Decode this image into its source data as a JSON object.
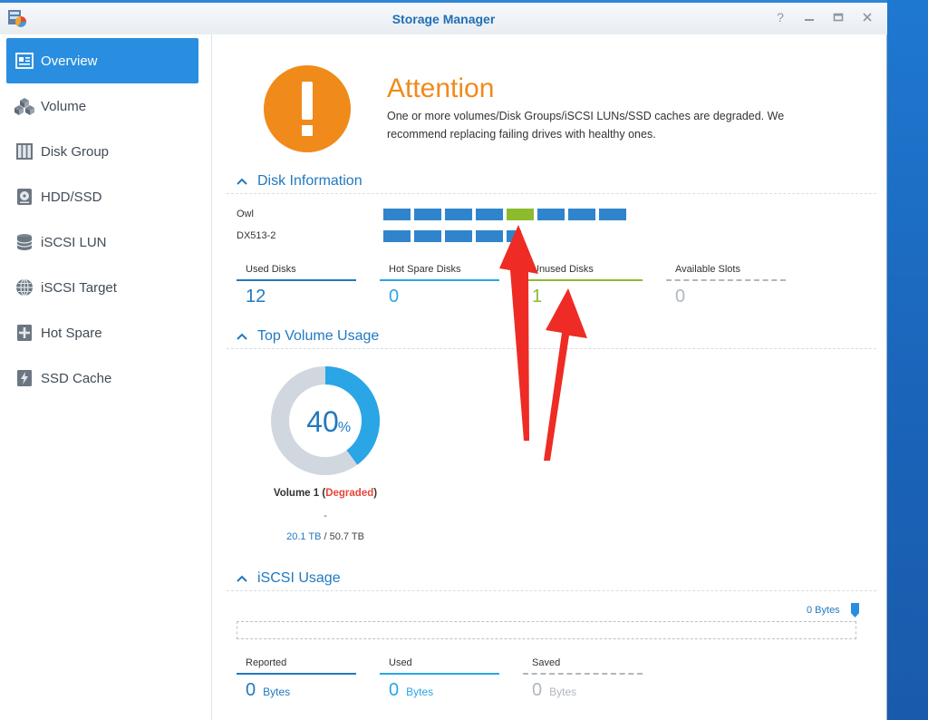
{
  "window": {
    "title": "Storage Manager",
    "controls": [
      "?",
      "–",
      "□",
      "×"
    ]
  },
  "sidebar": {
    "items": [
      {
        "label": "Overview",
        "icon": "overview-icon",
        "active": true
      },
      {
        "label": "Volume",
        "icon": "volume-icon"
      },
      {
        "label": "Disk Group",
        "icon": "disk-group-icon"
      },
      {
        "label": "HDD/SSD",
        "icon": "hdd-icon"
      },
      {
        "label": "iSCSI LUN",
        "icon": "iscsi-lun-icon"
      },
      {
        "label": "iSCSI Target",
        "icon": "iscsi-target-icon"
      },
      {
        "label": "Hot Spare",
        "icon": "hot-spare-icon"
      },
      {
        "label": "SSD Cache",
        "icon": "ssd-cache-icon"
      }
    ]
  },
  "attention": {
    "title": "Attention",
    "message_line1": "One or more volumes/Disk Groups/iSCSI LUNs/SSD caches are degraded. We",
    "message_line2": "recommend replacing failing drives with healthy ones.",
    "color": "#f08a1b"
  },
  "disk_info": {
    "header": "Disk Information",
    "devices": [
      {
        "name": "Owl",
        "disks": [
          "used",
          "used",
          "used",
          "used",
          "unused",
          "used",
          "used",
          "used"
        ]
      },
      {
        "name": "DX513-2",
        "disks": [
          "used",
          "used",
          "used",
          "used",
          "used"
        ]
      }
    ],
    "stats": [
      {
        "label": "Used Disks",
        "value": "12",
        "color": "#2179c0"
      },
      {
        "label": "Hot Spare Disks",
        "value": "0",
        "color": "#2aa6e6"
      },
      {
        "label": "Unused Disks",
        "value": "1",
        "color": "#8dbb2e"
      },
      {
        "label": "Available Slots",
        "value": "0",
        "color": "#b0b7bf"
      }
    ]
  },
  "volume_usage": {
    "header": "Top Volume Usage",
    "percent": "40",
    "percent_sign": "%",
    "percent_fraction": 0.4,
    "volume_name": "Volume 1 (",
    "status": "Degraded",
    "close_paren": ")",
    "dash": "-",
    "used": "20.1 TB",
    "separator": " / ",
    "total": "50.7 TB"
  },
  "iscsi_usage": {
    "header": "iSCSI Usage",
    "bar_label": "0 Bytes",
    "stats": [
      {
        "label": "Reported",
        "value": "0",
        "unit": "Bytes",
        "color": "#2179c0"
      },
      {
        "label": "Used",
        "value": "0",
        "unit": "Bytes",
        "color": "#2aa6e6"
      },
      {
        "label": "Saved",
        "value": "0",
        "unit": "Bytes",
        "color": "#b0b7bf"
      }
    ]
  },
  "colors": {
    "accent": "#2a8ee0",
    "used_disk": "#2f84cc",
    "unused_disk": "#8dbb2e",
    "donut_used": "#2aa6e6",
    "donut_free": "#d0d7df",
    "annotation_arrow": "#ee2b24"
  }
}
